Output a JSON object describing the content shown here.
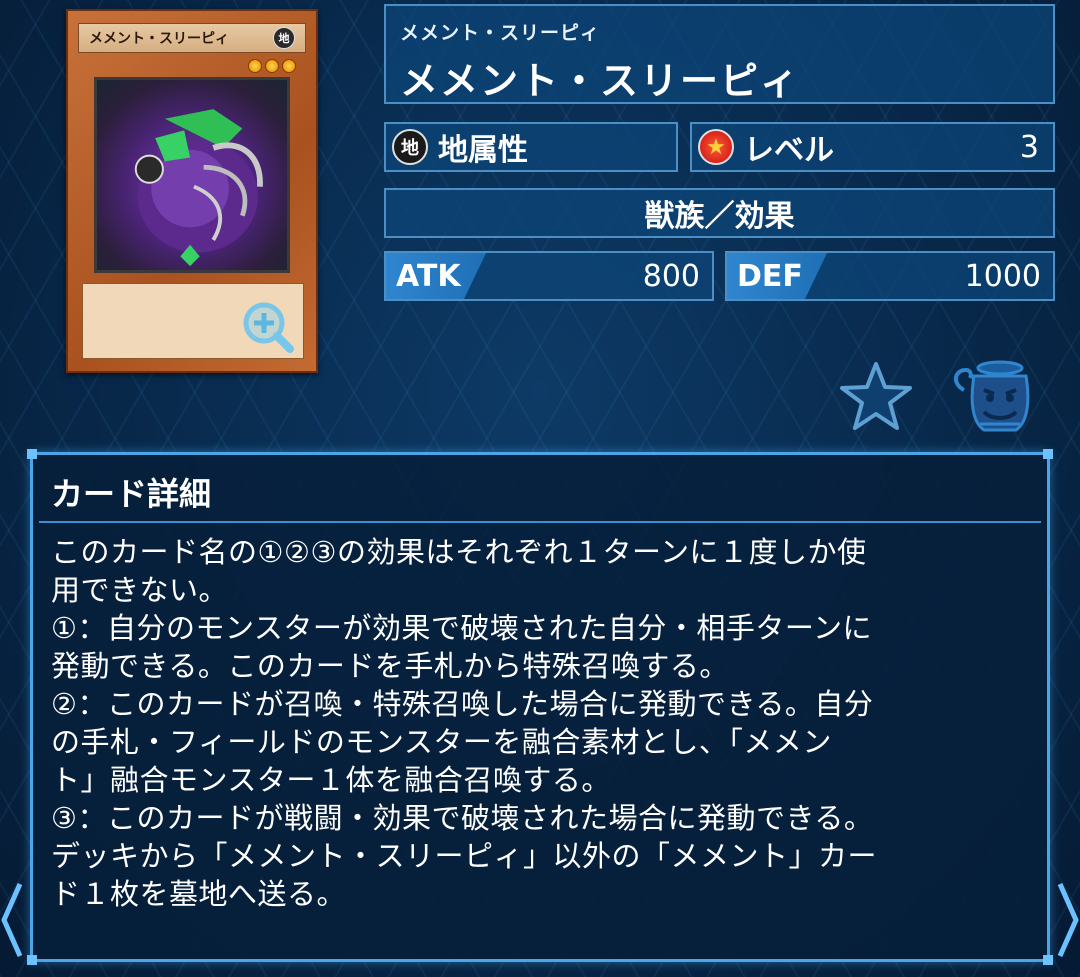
{
  "card": {
    "thumb_name": "メメント・スリーピィ",
    "thumb_attribute": "地",
    "ruby": "メメント・スリーピィ",
    "name": "メメント・スリーピィ"
  },
  "attribute": {
    "icon": "earth-attribute-icon",
    "icon_char": "地",
    "label": "地属性"
  },
  "level": {
    "icon": "level-star-icon",
    "label": "レベル",
    "value": "3"
  },
  "type_line": "獣族／効果",
  "atk": {
    "label": "ATK",
    "value": "800"
  },
  "def": {
    "label": "DEF",
    "value": "1000"
  },
  "actions": {
    "favorite_icon": "star-icon",
    "pot_icon": "pot-of-greed-icon"
  },
  "detail": {
    "title": "カード詳細",
    "lines": [
      "このカード名の①②③の効果はそれぞれ１ターンに１度しか使",
      "用できない。",
      "①：自分のモンスターが効果で破壊された自分・相手ターンに",
      "発動できる。このカードを手札から特殊召喚する。",
      "②：このカードが召喚・特殊召喚した場合に発動できる。自分",
      "の手札・フィールドのモンスターを融合素材とし、「メメン",
      "ト」融合モンスター１体を融合召喚する。",
      "③：このカードが戦闘・効果で破壊された場合に発動できる。",
      "デッキから「メメント・スリーピィ」以外の「メメント」カー",
      "ド１枚を墓地へ送る。"
    ]
  },
  "colors": {
    "accent": "#4aa6e6",
    "panel": "#0c4678",
    "card_frame": "#b9602a"
  }
}
